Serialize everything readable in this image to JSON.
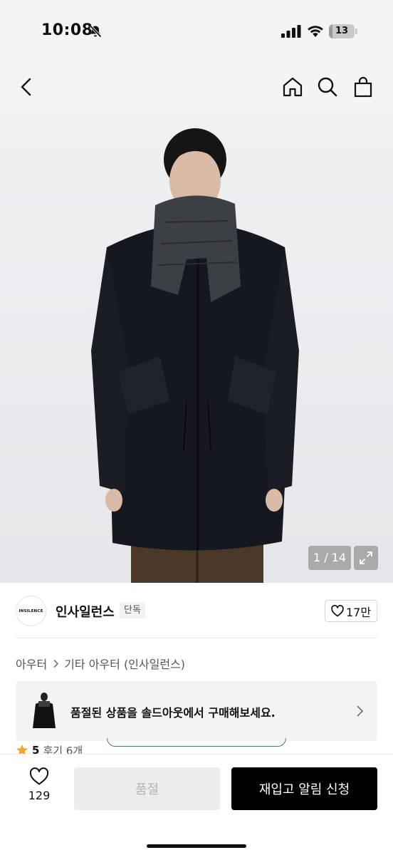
{
  "status_bar": {
    "time": "10:08",
    "battery_level": "13",
    "battery_fraction": 0.13,
    "icons": [
      "bell-off-icon",
      "signal-icon",
      "wifi-icon",
      "battery-icon"
    ]
  },
  "header": {
    "icons": [
      "back-icon",
      "home-icon",
      "search-icon",
      "shopping-bag-icon"
    ]
  },
  "gallery": {
    "counter": "1 / 14",
    "expand_icon": "expand-icon"
  },
  "brand": {
    "logo_text": "INSILENCE",
    "name": "인사일런스",
    "badge": "단독",
    "likes": "17만"
  },
  "breadcrumb": {
    "items": [
      "아우터",
      "기타 아우터 (인사일런스)"
    ]
  },
  "soldout_banner": {
    "text": "품절된 상품을 솔드아웃에서 구매해보세요."
  },
  "rating": {
    "score": "5",
    "reviews": "후기 6개"
  },
  "bottom_bar": {
    "wishlist_count": "129",
    "soldout_label": "품절",
    "restock_label": "재입고 알림 신청"
  },
  "colors": {
    "accent": "#000000",
    "star": "#f5a623",
    "disabled_bg": "#ececec",
    "disabled_text": "#b5b5b5",
    "banner_bg": "#f4f4f4"
  }
}
